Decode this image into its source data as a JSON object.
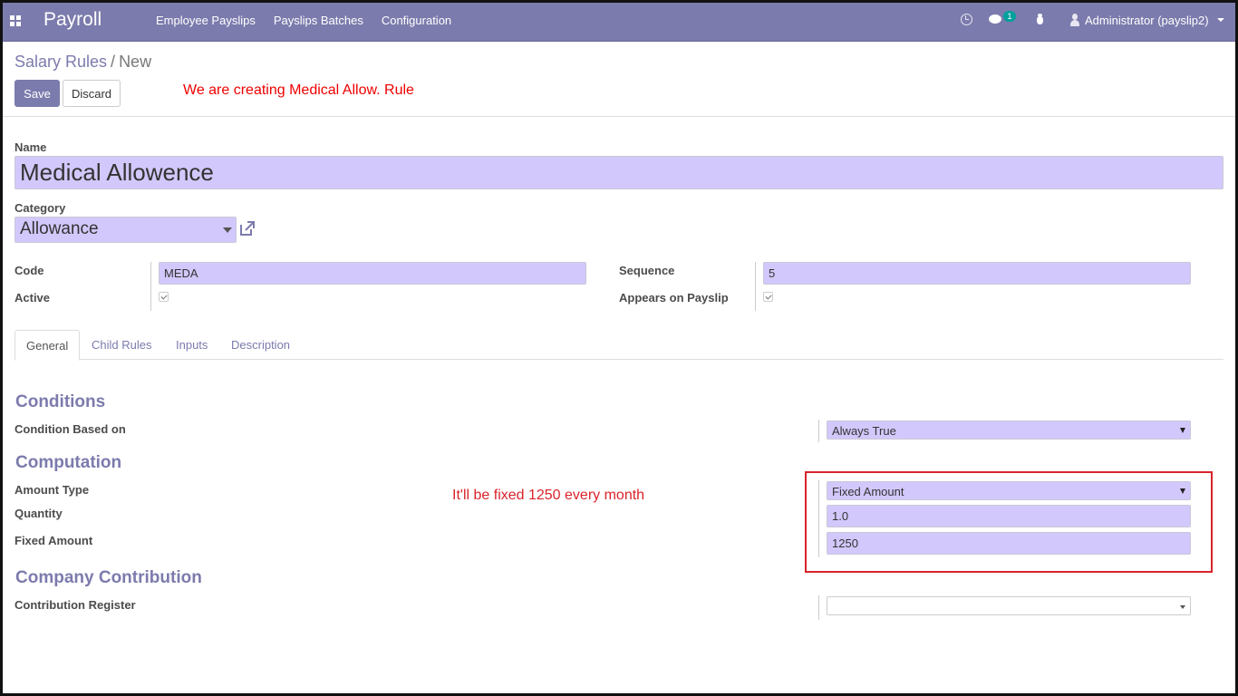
{
  "navbar": {
    "brand": "Payroll",
    "menu": [
      "Employee Payslips",
      "Payslips Batches",
      "Configuration"
    ],
    "chat_badge": "1",
    "user": "Administrator (payslip2)",
    "icons": [
      "apps-icon",
      "clock-icon",
      "chat-icon",
      "bug-icon",
      "user-icon"
    ]
  },
  "breadcrumb": {
    "parent": "Salary Rules",
    "separator": "/",
    "current": "New"
  },
  "buttons": {
    "save": "Save",
    "discard": "Discard"
  },
  "annotations": {
    "top": "We are creating Medical Allow. Rule",
    "middle": "It'll be fixed 1250 every month"
  },
  "form": {
    "name_label": "Name",
    "name_value": "Medical Allowence",
    "category_label": "Category",
    "category_value": "Allowance",
    "code_label": "Code",
    "code_value": "MEDA",
    "active_label": "Active",
    "active_checked": true,
    "sequence_label": "Sequence",
    "sequence_value": "5",
    "appears_label": "Appears on Payslip",
    "appears_checked": true
  },
  "tabs": [
    "General",
    "Child Rules",
    "Inputs",
    "Description"
  ],
  "active_tab": "General",
  "conditions": {
    "title": "Conditions",
    "based_on_label": "Condition Based on",
    "based_on_value": "Always True"
  },
  "computation": {
    "title": "Computation",
    "amount_type_label": "Amount Type",
    "amount_type_value": "Fixed Amount",
    "quantity_label": "Quantity",
    "quantity_value": "1.0",
    "fixed_amount_label": "Fixed Amount",
    "fixed_amount_value": "1250"
  },
  "contribution": {
    "title": "Company Contribution",
    "register_label": "Contribution Register",
    "register_value": ""
  },
  "colors": {
    "brand": "#7c7bad",
    "field": "#d3c8fb",
    "annotation": "#d9232a",
    "badge": "#00a09d"
  }
}
